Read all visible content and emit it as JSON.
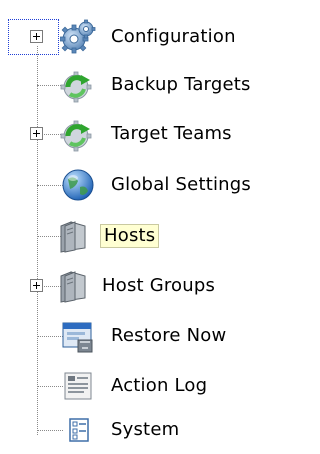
{
  "tree": {
    "items": [
      {
        "label": "Configuration",
        "icon": "gears-icon",
        "expandable": true,
        "focused": true
      },
      {
        "label": "Backup Targets",
        "icon": "green-refresh-gear-icon",
        "expandable": false
      },
      {
        "label": "Target Teams",
        "icon": "green-refresh-gear-icon",
        "expandable": true
      },
      {
        "label": "Global Settings",
        "icon": "globe-icon",
        "expandable": false
      },
      {
        "label": "Hosts",
        "icon": "server-icon",
        "expandable": false,
        "selected": true
      },
      {
        "label": "Host Groups",
        "icon": "server-icon",
        "expandable": true
      },
      {
        "label": "Restore Now",
        "icon": "restore-window-icon",
        "expandable": false
      },
      {
        "label": "Action Log",
        "icon": "log-document-icon",
        "expandable": false
      },
      {
        "label": "System",
        "icon": "system-list-icon",
        "expandable": false
      }
    ]
  }
}
